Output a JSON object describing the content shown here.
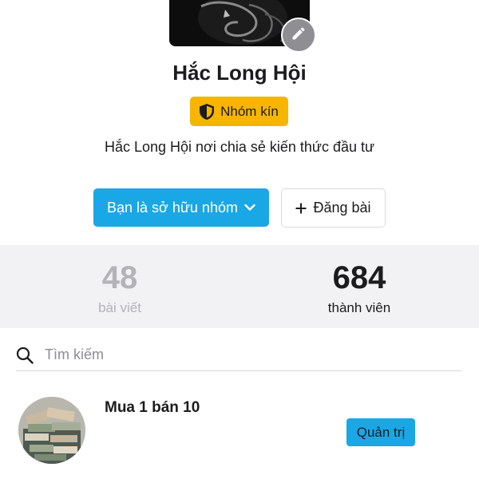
{
  "group": {
    "name": "Hắc Long Hội",
    "privacy_label": "Nhóm kín",
    "description": "Hắc Long Hội nơi chia sẻ kiến thức đầu tư"
  },
  "actions": {
    "owner_label": "Bạn là sở hữu nhóm",
    "post_label": "Đăng bài"
  },
  "stats": {
    "posts": {
      "value": "48",
      "label": "bài viết"
    },
    "members": {
      "value": "684",
      "label": "thành viên"
    }
  },
  "search": {
    "placeholder": "Tìm kiếm"
  },
  "members_list": [
    {
      "name": "Mua 1 bán 10",
      "role": "Quản trị"
    }
  ],
  "colors": {
    "accent": "#1aa7e6",
    "privacy_badge": "#f7b500",
    "stats_background": "#f2f2f4",
    "muted_text": "#b3b3b8"
  },
  "icons": {
    "edit": "pencil-icon",
    "privacy": "shield-icon",
    "dropdown": "chevron-down-icon",
    "post": "plus-icon",
    "search": "search-icon"
  }
}
